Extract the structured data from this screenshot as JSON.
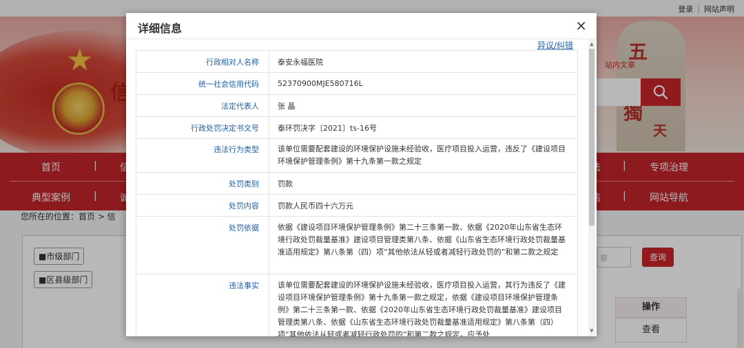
{
  "top_links": {
    "login": "登录",
    "separator": "|",
    "statement": "网站声明"
  },
  "banner": {
    "title_partial": "信",
    "site_search_label": "站内文章",
    "stone_chars": [
      "五",
      "獨",
      "天"
    ]
  },
  "nav": {
    "row1": [
      "首页",
      "信",
      "法",
      "专项治理"
    ],
    "row2": [
      "典型案例",
      "诚",
      "信",
      "网站导航"
    ],
    "separator": "|"
  },
  "breadcrumb": "您所在的位置：首页 > 信",
  "departments": {
    "city": "市级部门",
    "county": "区县级部门"
  },
  "search": {
    "placeholder": "容",
    "query_button": "查询"
  },
  "result_table": {
    "header_action": "操作",
    "view_label": "查看"
  },
  "modal": {
    "title": "详细信息",
    "close_symbol": "×",
    "dispute_link": "异议/纠错",
    "rows": [
      {
        "label": "行政相对人名称",
        "value": "泰安永福医院"
      },
      {
        "label": "统一社会信用代码",
        "value": "52370900MJE580716L"
      },
      {
        "label": "法定代表人",
        "value": "张 晶"
      },
      {
        "label": "行政处罚决定书文号",
        "value": "泰环罚决字〔2021〕ts-16号"
      },
      {
        "label": "违法行为类型",
        "value": "该单位需要配套建设的环境保护设施未经验收，医疗项目投入运营，违反了《建设项目环境保护管理条例》第十九条第一款之规定"
      },
      {
        "label": "处罚类别",
        "value": "罚款"
      },
      {
        "label": "处罚内容",
        "value": "罚款人民币四十六万元"
      },
      {
        "label": "处罚依据",
        "value": "依据《建设项目环境保护管理条例》第二十三条第一款、依据《2020年山东省生态环境行政处罚裁量基准》建设项目管理类第八条、依据《山东省生态环境行政处罚裁量基准适用规定》第八条第（四）项“其他依法从轻或者减轻行政处罚的”和第二款之规定"
      },
      {
        "label": "违法事实",
        "value": "该单位需要配套建设的环境保护设施未经验收，医疗项目投入运营，其行为违反了《建设项目环境保护管理条例》第十九条第一款之规定，依据《建设项目环境保护管理条例》第二十三条第一款、依据《2020年山东省生态环境行政处罚裁量基准》建设项目管理类第八条、依据《山东省生态环境行政处罚裁量基准适用规定》第八条第（四）项“其他依法从轻或者减轻行政处罚的”和第二款之规定，应予处"
      }
    ]
  },
  "colors": {
    "brand_red": "#c3242c",
    "link_blue": "#1f5fa5"
  }
}
